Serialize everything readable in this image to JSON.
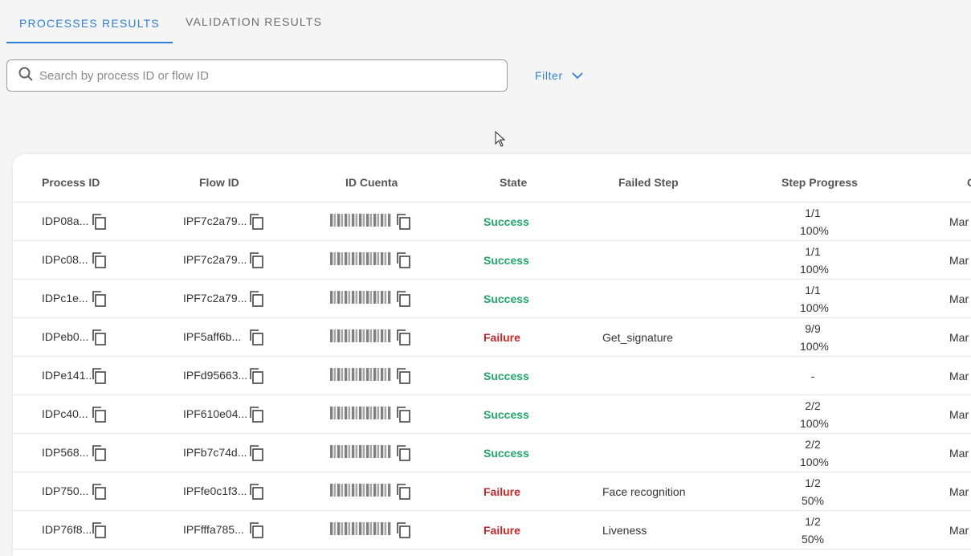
{
  "tabs": [
    {
      "label": "PROCESSES RESULTS",
      "active": true
    },
    {
      "label": "VALIDATION RESULTS",
      "active": false
    }
  ],
  "search": {
    "placeholder": "Search by process ID or flow ID",
    "value": ""
  },
  "filter": {
    "label": "Filter"
  },
  "table": {
    "headers": [
      "Process ID",
      "Flow ID",
      "ID Cuenta",
      "State",
      "Failed Step",
      "Step Progress",
      "C"
    ],
    "rows": [
      {
        "process_id": "IDP08a...",
        "flow_id": "IPF7c2a79...",
        "state": "Success",
        "failed_step": "",
        "progress_count": "1/1",
        "progress_pct": "100%",
        "date": "Mar"
      },
      {
        "process_id": "IDPc08...",
        "flow_id": "IPF7c2a79...",
        "state": "Success",
        "failed_step": "",
        "progress_count": "1/1",
        "progress_pct": "100%",
        "date": "Mar"
      },
      {
        "process_id": "IDPc1e...",
        "flow_id": "IPF7c2a79...",
        "state": "Success",
        "failed_step": "",
        "progress_count": "1/1",
        "progress_pct": "100%",
        "date": "Mar"
      },
      {
        "process_id": "IDPeb0...",
        "flow_id": "IPF5aff6b...",
        "state": "Failure",
        "failed_step": "Get_signature",
        "progress_count": "9/9",
        "progress_pct": "100%",
        "date": "Mar"
      },
      {
        "process_id": "IDPe141...",
        "flow_id": "IPFd95663...",
        "state": "Success",
        "failed_step": "",
        "progress_count": "-",
        "progress_pct": "",
        "date": "Mar"
      },
      {
        "process_id": "IDPc40...",
        "flow_id": "IPF610e04...",
        "state": "Success",
        "failed_step": "",
        "progress_count": "2/2",
        "progress_pct": "100%",
        "date": "Mar"
      },
      {
        "process_id": "IDP568...",
        "flow_id": "IPFb7c74d...",
        "state": "Success",
        "failed_step": "",
        "progress_count": "2/2",
        "progress_pct": "100%",
        "date": "Mar"
      },
      {
        "process_id": "IDP750...",
        "flow_id": "IPFfe0c1f3...",
        "state": "Failure",
        "failed_step": "Face recognition",
        "progress_count": "1/2",
        "progress_pct": "50%",
        "date": "Mar"
      },
      {
        "process_id": "IDP76f8...",
        "flow_id": "IPFfffa785...",
        "state": "Failure",
        "failed_step": "Liveness",
        "progress_count": "1/2",
        "progress_pct": "50%",
        "date": "Mar"
      }
    ]
  },
  "icons": {
    "search": "search-icon",
    "chevron": "chevron-down-icon",
    "copy": "copy-icon",
    "cursor": "mouse-cursor-icon"
  },
  "colors": {
    "accent": "#2f7fd4",
    "success": "#22a66a",
    "failure": "#c62828"
  }
}
